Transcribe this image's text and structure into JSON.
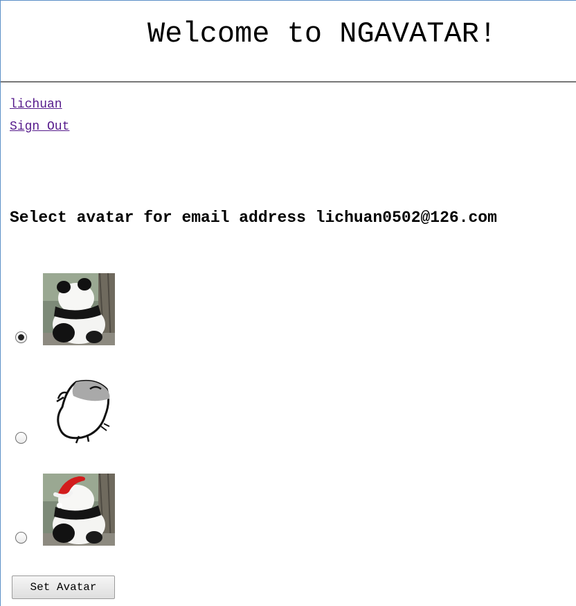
{
  "header": {
    "title": "Welcome to NGAVATAR!"
  },
  "nav": {
    "user_link": "lichuan",
    "signout_link": "Sign Out"
  },
  "main": {
    "prompt": "Select avatar for email address lichuan0502@126.com",
    "avatars": [
      {
        "icon": "panda-avatar-icon",
        "selected": true
      },
      {
        "icon": "cartoon-chick-avatar-icon",
        "selected": false
      },
      {
        "icon": "panda-santa-hat-avatar-icon",
        "selected": false
      }
    ],
    "set_button_label": "Set Avatar"
  },
  "colors": {
    "frame_border": "#5b8fc7",
    "link": "#551a8b",
    "rule": "#777777"
  }
}
